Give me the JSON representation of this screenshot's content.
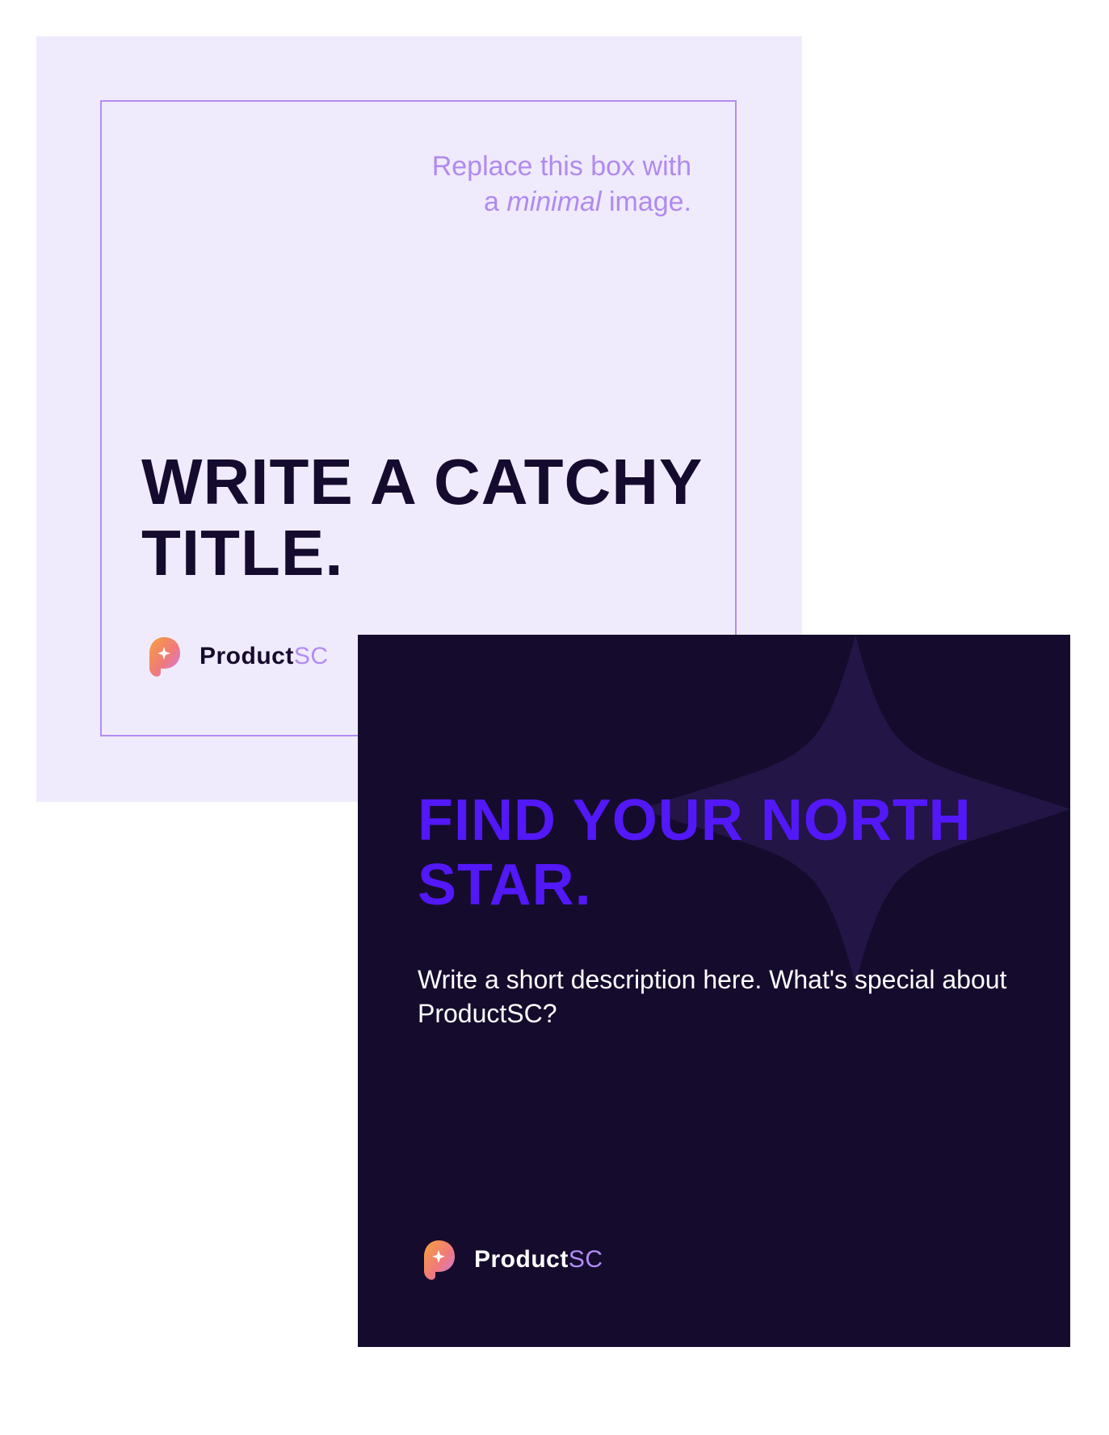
{
  "light_card": {
    "placeholder_line1": "Replace this box with",
    "placeholder_line2_pre": "a ",
    "placeholder_line2_italic": "minimal",
    "placeholder_line2_post": " image.",
    "title": "WRITE A CATCHY TITLE.",
    "brand": {
      "base": "Product",
      "accent": "SC"
    }
  },
  "dark_card": {
    "title": "FIND YOUR NORTH STAR.",
    "description": "Write a short description here. What's special about ProductSC?",
    "brand": {
      "base": "Product",
      "accent": "SC"
    }
  },
  "colors": {
    "light_bg": "#f0ebfc",
    "frame": "#b28cf5",
    "dark_bg": "#150b2d",
    "dark_title": "#5318f7",
    "ink": "#150b2e"
  },
  "icons": [
    "productsc-logo-icon",
    "north-star-icon"
  ]
}
